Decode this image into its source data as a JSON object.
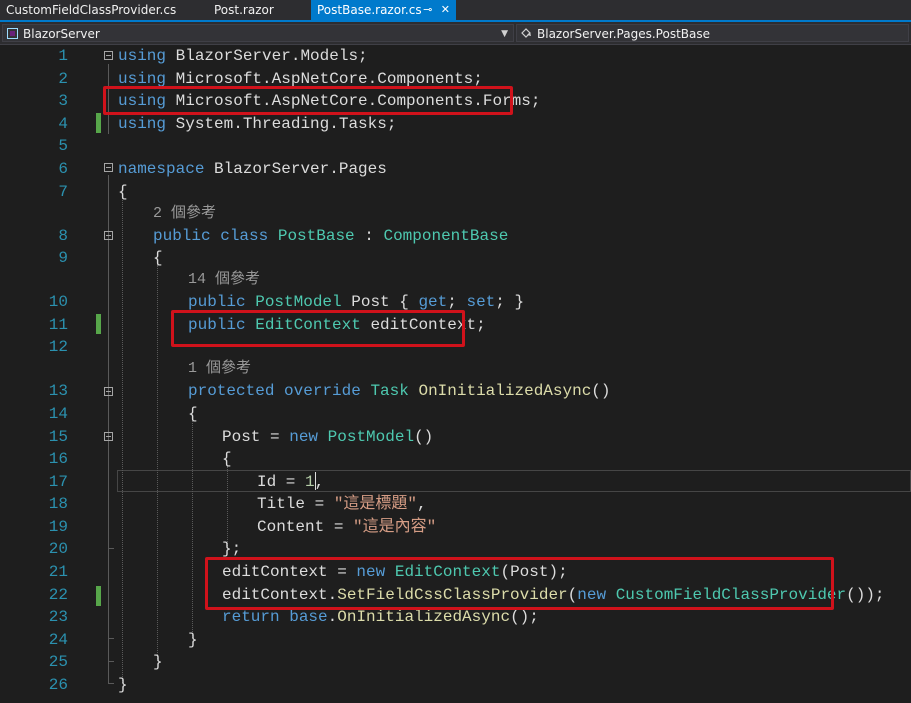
{
  "tabs": [
    {
      "label": "CustomFieldClassProvider.cs",
      "active": false
    },
    {
      "label": "Post.razor",
      "active": false
    },
    {
      "label": "PostBase.razor.cs",
      "active": true
    }
  ],
  "tab_icons": {
    "pin": "pin-icon",
    "close": "close-icon"
  },
  "navbar": {
    "project": "BlazorServer",
    "scope": "BlazorServer.Pages.PostBase"
  },
  "line_numbers": [
    "1",
    "2",
    "3",
    "4",
    "5",
    "6",
    "7",
    "8",
    "9",
    "10",
    "11",
    "12",
    "13",
    "14",
    "15",
    "16",
    "17",
    "18",
    "19",
    "20",
    "21",
    "22",
    "23",
    "24",
    "25",
    "26"
  ],
  "codelens": {
    "class_refs": "2 個參考",
    "property_refs": "14 個參考",
    "method_refs": "1 個參考"
  },
  "code": {
    "l1": [
      "using",
      " BlazorServer.Models;"
    ],
    "l2": [
      "using",
      " Microsoft.AspNetCore.Components;"
    ],
    "l3": [
      "using",
      " Microsoft.AspNetCore.Components.Forms;"
    ],
    "l4": [
      "using",
      " System.Threading.Tasks;"
    ],
    "l6": [
      "namespace",
      " BlazorServer.Pages"
    ],
    "l7": "{",
    "l8": [
      "public",
      " ",
      "class",
      " ",
      "PostBase",
      " : ",
      "ComponentBase"
    ],
    "l9": "{",
    "l10": [
      "public",
      " ",
      "PostModel",
      " Post { ",
      "get",
      "; ",
      "set",
      "; }"
    ],
    "l11": [
      "public",
      " ",
      "EditContext",
      " editContext;"
    ],
    "l13": [
      "protected",
      " ",
      "override",
      " ",
      "Task",
      " ",
      "OnInitializedAsync",
      "()"
    ],
    "l14": "{",
    "l15": [
      "Post = ",
      "new",
      " ",
      "PostModel",
      "()"
    ],
    "l16": "{",
    "l17": [
      "Id = ",
      "1",
      ","
    ],
    "l18": [
      "Title = ",
      "\"這是標題\"",
      ","
    ],
    "l19": [
      "Content = ",
      "\"這是內容\""
    ],
    "l20": "};",
    "l21": [
      "editContext = ",
      "new",
      " ",
      "EditContext",
      "(Post);"
    ],
    "l22": [
      "editContext.",
      "SetFieldCssClassProvider",
      "(",
      "new",
      " ",
      "CustomFieldClassProvider",
      "());"
    ],
    "l23": [
      "return",
      " ",
      "base",
      ".",
      "OnInitializedAsync",
      "();"
    ],
    "l24": "}",
    "l25": "}",
    "l26": "}"
  },
  "colors": {
    "background": "#1e1e1e",
    "keyword": "#569cd6",
    "type": "#4ec9b0",
    "string": "#d69d85",
    "number": "#b5cea8",
    "method": "#dcdcaa",
    "line_number": "#2b91af",
    "highlight_box": "#d0121b",
    "change_marker": "#57a64a",
    "active_tab": "#007acc"
  }
}
